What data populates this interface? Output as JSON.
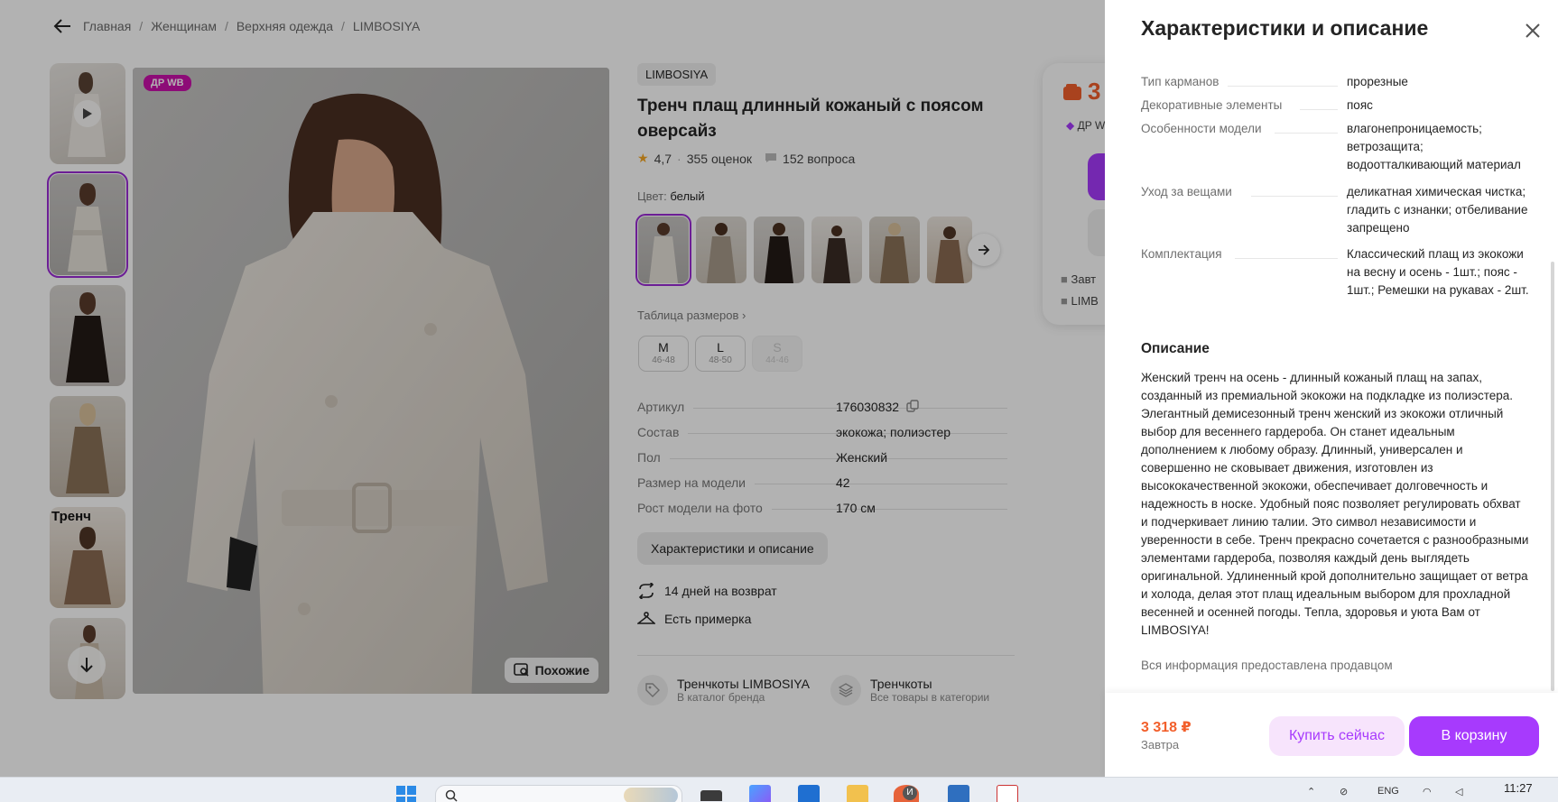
{
  "breadcrumb": [
    "Главная",
    "Женщинам",
    "Верхняя одежда",
    "LIMBOSIYA"
  ],
  "gallery": {
    "badge": "ДР WB",
    "similar_label": "Похожие",
    "thumb_text": "Тренч"
  },
  "product": {
    "brand": "LIMBOSIYA",
    "title": "Тренч плащ длинный кожаный с поясом оверсайз",
    "rating": "4,7",
    "reviews": "355 оценок",
    "questions": "152 вопроса",
    "color_label": "Цвет:",
    "color_value": "белый",
    "size_table_label": "Таблица размеров",
    "sizes": [
      {
        "size": "M",
        "range": "46-48"
      },
      {
        "size": "L",
        "range": "48-50"
      },
      {
        "size": "S",
        "range": "44-46"
      }
    ],
    "params": [
      {
        "key": "Артикул",
        "value": "176030832"
      },
      {
        "key": "Состав",
        "value": "экокожа; полиэстер"
      },
      {
        "key": "Пол",
        "value": "Женский"
      },
      {
        "key": "Размер на модели",
        "value": "42"
      },
      {
        "key": "Рост модели на фото",
        "value": "170 см"
      }
    ],
    "char_button": "Характеристики и описание",
    "return_text": "14 дней на возврат",
    "fitting_text": "Есть примерка",
    "links": [
      {
        "title": "Тренчкоты LIMBOSIYA",
        "sub": "В каталог бренда"
      },
      {
        "title": "Тренчкоты",
        "sub": "Все товары в категории"
      }
    ]
  },
  "price_card": {
    "price_partial": "3",
    "wb_partial": "ДР W",
    "line1": "Завт",
    "line2": "LIMB"
  },
  "drawer": {
    "title": "Характеристики и описание",
    "specs": [
      {
        "key": "Тип карманов",
        "value": "прорезные"
      },
      {
        "key": "Декоративные элементы",
        "value": "пояс"
      },
      {
        "key": "Особенности модели",
        "value": "влагонепроницаемость; ветрозащита; водоотталкивающий материал"
      },
      {
        "key": "Уход за вещами",
        "value": "деликатная химическая чистка; гладить с изнанки; отбеливание запрещено"
      },
      {
        "key": "Комплектация",
        "value": "Классический плащ из экокожи на весну и осень - 1шт.; пояс - 1шт.; Ремешки на рукавах - 2шт."
      }
    ],
    "description_title": "Описание",
    "description": "Женский тренч на осень - длинный кожаный плащ на запах, созданный из премиальной экокожи на подкладке из полиэстера. Элегантный демисезонный тренч женский из экокожи отличный выбор для весеннего гардероба. Он станет идеальным дополнением к любому образу. Длинный, универсален и совершенно не сковывает движения, изготовлен из высококачественной экокожи, обеспечивает долговечность и надежность в носке. Удобный пояс позволяет регулировать обхват и подчеркивает линию талии. Это символ независимости и уверенности в себе. Тренч прекрасно сочетается с разнообразными элементами гардероба, позволяя каждый день выглядеть оригинальной. Удлиненный крой дополнительно защищает от ветра и холода, делая этот плащ идеальным выбором для прохладной весенней и осенней погоды. Тепла, здоровья и уюта Вам от LIMBOSIYA!",
    "provided_by": "Вся информация предоставлена продавцом",
    "footer_price": "3 318 ₽",
    "footer_when": "Завтра",
    "buy_now": "Купить сейчас",
    "to_cart": "В корзину"
  },
  "taskbar": {
    "lang": "ENG",
    "time": "11:27",
    "badge": "И"
  },
  "colors": {
    "accent": "#a73afd",
    "price": "#f25f2b",
    "badge": "#cb11ab"
  }
}
